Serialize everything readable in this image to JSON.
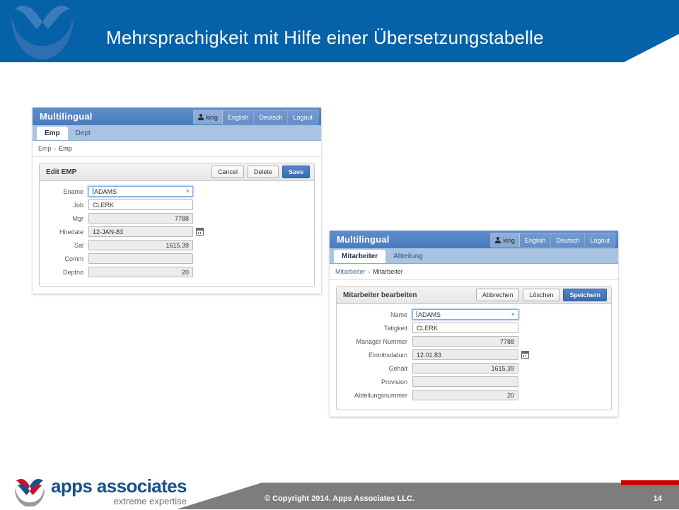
{
  "slide": {
    "title": "Mehrsprachigkeit mit Hilfe einer Übersetzungstabelle",
    "banner_color": "#0561a8",
    "logo_watermark_icon": "apps-associates-logo-icon"
  },
  "app_en": {
    "brand": "Multilingual",
    "nav": {
      "user_icon": "user-icon",
      "user": "king",
      "links": [
        "English",
        "Deutsch",
        "Logout"
      ]
    },
    "tabs": [
      {
        "label": "Emp",
        "active": true
      },
      {
        "label": "Dept",
        "active": false
      }
    ],
    "breadcrumb": {
      "root": "Emp",
      "separator": "›",
      "current": "Emp"
    },
    "panel": {
      "title": "Edit EMP",
      "buttons": [
        {
          "label": "Cancel",
          "style": "plain"
        },
        {
          "label": "Delete",
          "style": "plain"
        },
        {
          "label": "Save",
          "style": "primary"
        }
      ]
    },
    "fields": [
      {
        "label": "Ename",
        "value": "ADAMS",
        "align": "left",
        "state": "focused",
        "clear": "×"
      },
      {
        "label": "Job",
        "value": "CLERK",
        "align": "left",
        "state": "normal"
      },
      {
        "label": "Mgr",
        "value": "7788",
        "align": "right",
        "state": "readonly"
      },
      {
        "label": "Hiredate",
        "value": "12-JAN-83",
        "align": "left",
        "state": "readonly",
        "icon": "calendar-icon"
      },
      {
        "label": "Sal",
        "value": "1615.39",
        "align": "right",
        "state": "readonly"
      },
      {
        "label": "Comm",
        "value": "",
        "align": "left",
        "state": "readonly"
      },
      {
        "label": "Deptno",
        "value": "20",
        "align": "right",
        "state": "readonly"
      }
    ]
  },
  "app_de": {
    "brand": "Multilingual",
    "nav": {
      "user_icon": "user-icon",
      "user": "king",
      "links": [
        "English",
        "Deutsch",
        "Logout"
      ]
    },
    "tabs": [
      {
        "label": "Mitarbeiter",
        "active": true
      },
      {
        "label": "Abteilung",
        "active": false
      }
    ],
    "breadcrumb": {
      "root": "Mitarbeiter",
      "separator": "›",
      "current": "Mitarbeiter"
    },
    "panel": {
      "title": "Mitarbeiter bearbeiten",
      "buttons": [
        {
          "label": "Abbrechen",
          "style": "plain"
        },
        {
          "label": "Löschen",
          "style": "plain"
        },
        {
          "label": "Speichern",
          "style": "primary"
        }
      ]
    },
    "fields": [
      {
        "label": "Name",
        "value": "ADAMS",
        "align": "left",
        "state": "focused",
        "clear": "×"
      },
      {
        "label": "Tatigkeit",
        "value": "CLERK",
        "align": "left",
        "state": "normal"
      },
      {
        "label": "Manager Nummer",
        "value": "7788",
        "align": "right",
        "state": "readonly"
      },
      {
        "label": "Eintrittsdatum",
        "value": "12.01.83",
        "align": "left",
        "state": "readonly",
        "icon": "calendar-icon"
      },
      {
        "label": "Gehalt",
        "value": "1615,39",
        "align": "right",
        "state": "readonly"
      },
      {
        "label": "Provision",
        "value": "",
        "align": "left",
        "state": "readonly"
      },
      {
        "label": "Abteilungsnummer",
        "value": "20",
        "align": "right",
        "state": "readonly"
      }
    ]
  },
  "footer": {
    "copyright": "© Copyright 2014. Apps Associates LLC.",
    "page_number": "14",
    "logo_main": "apps associates",
    "logo_sub": "extreme expertise",
    "logo_icon": "apps-associates-logo-icon",
    "accent_color": "#cc0000",
    "bar_color": "#7d7d7d"
  }
}
